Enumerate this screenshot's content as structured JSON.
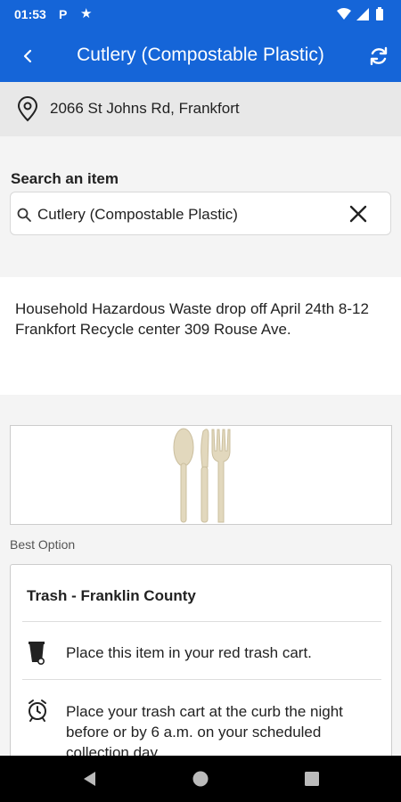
{
  "status_bar": {
    "time": "01:53",
    "p_icon": "P",
    "icons": [
      "parking-icon",
      "star-icon",
      "wifi-icon",
      "signal-icon",
      "battery-icon"
    ]
  },
  "app_bar": {
    "title": "Cutlery (Compostable Plastic)",
    "back_icon": "chevron-left-icon",
    "refresh_icon": "refresh-icon",
    "color": "#1565d8"
  },
  "address": {
    "text": "2066 St Johns Rd, Frankfort",
    "icon": "location-pin-icon"
  },
  "search": {
    "label": "Search an item",
    "value": "Cutlery (Compostable Plastic)",
    "clear_icon": "close-icon"
  },
  "notice": {
    "text": "Household Hazardous Waste drop off April 24th 8-12\nFrankfort Recycle center 309 Rouse Ave."
  },
  "item": {
    "image_icon": "cutlery-image"
  },
  "best_option": {
    "label": "Best Option",
    "title": "Trash - Franklin County",
    "rows": [
      {
        "icon": "trash-cart-icon",
        "text": "Place this item in your red trash cart."
      },
      {
        "icon": "alarm-clock-icon",
        "text": "Place your trash cart at the curb the night before or by 6 a.m. on your scheduled collection day."
      }
    ]
  },
  "nav_bar": {
    "icons": [
      "back-triangle-icon",
      "home-circle-icon",
      "recent-square-icon"
    ]
  }
}
